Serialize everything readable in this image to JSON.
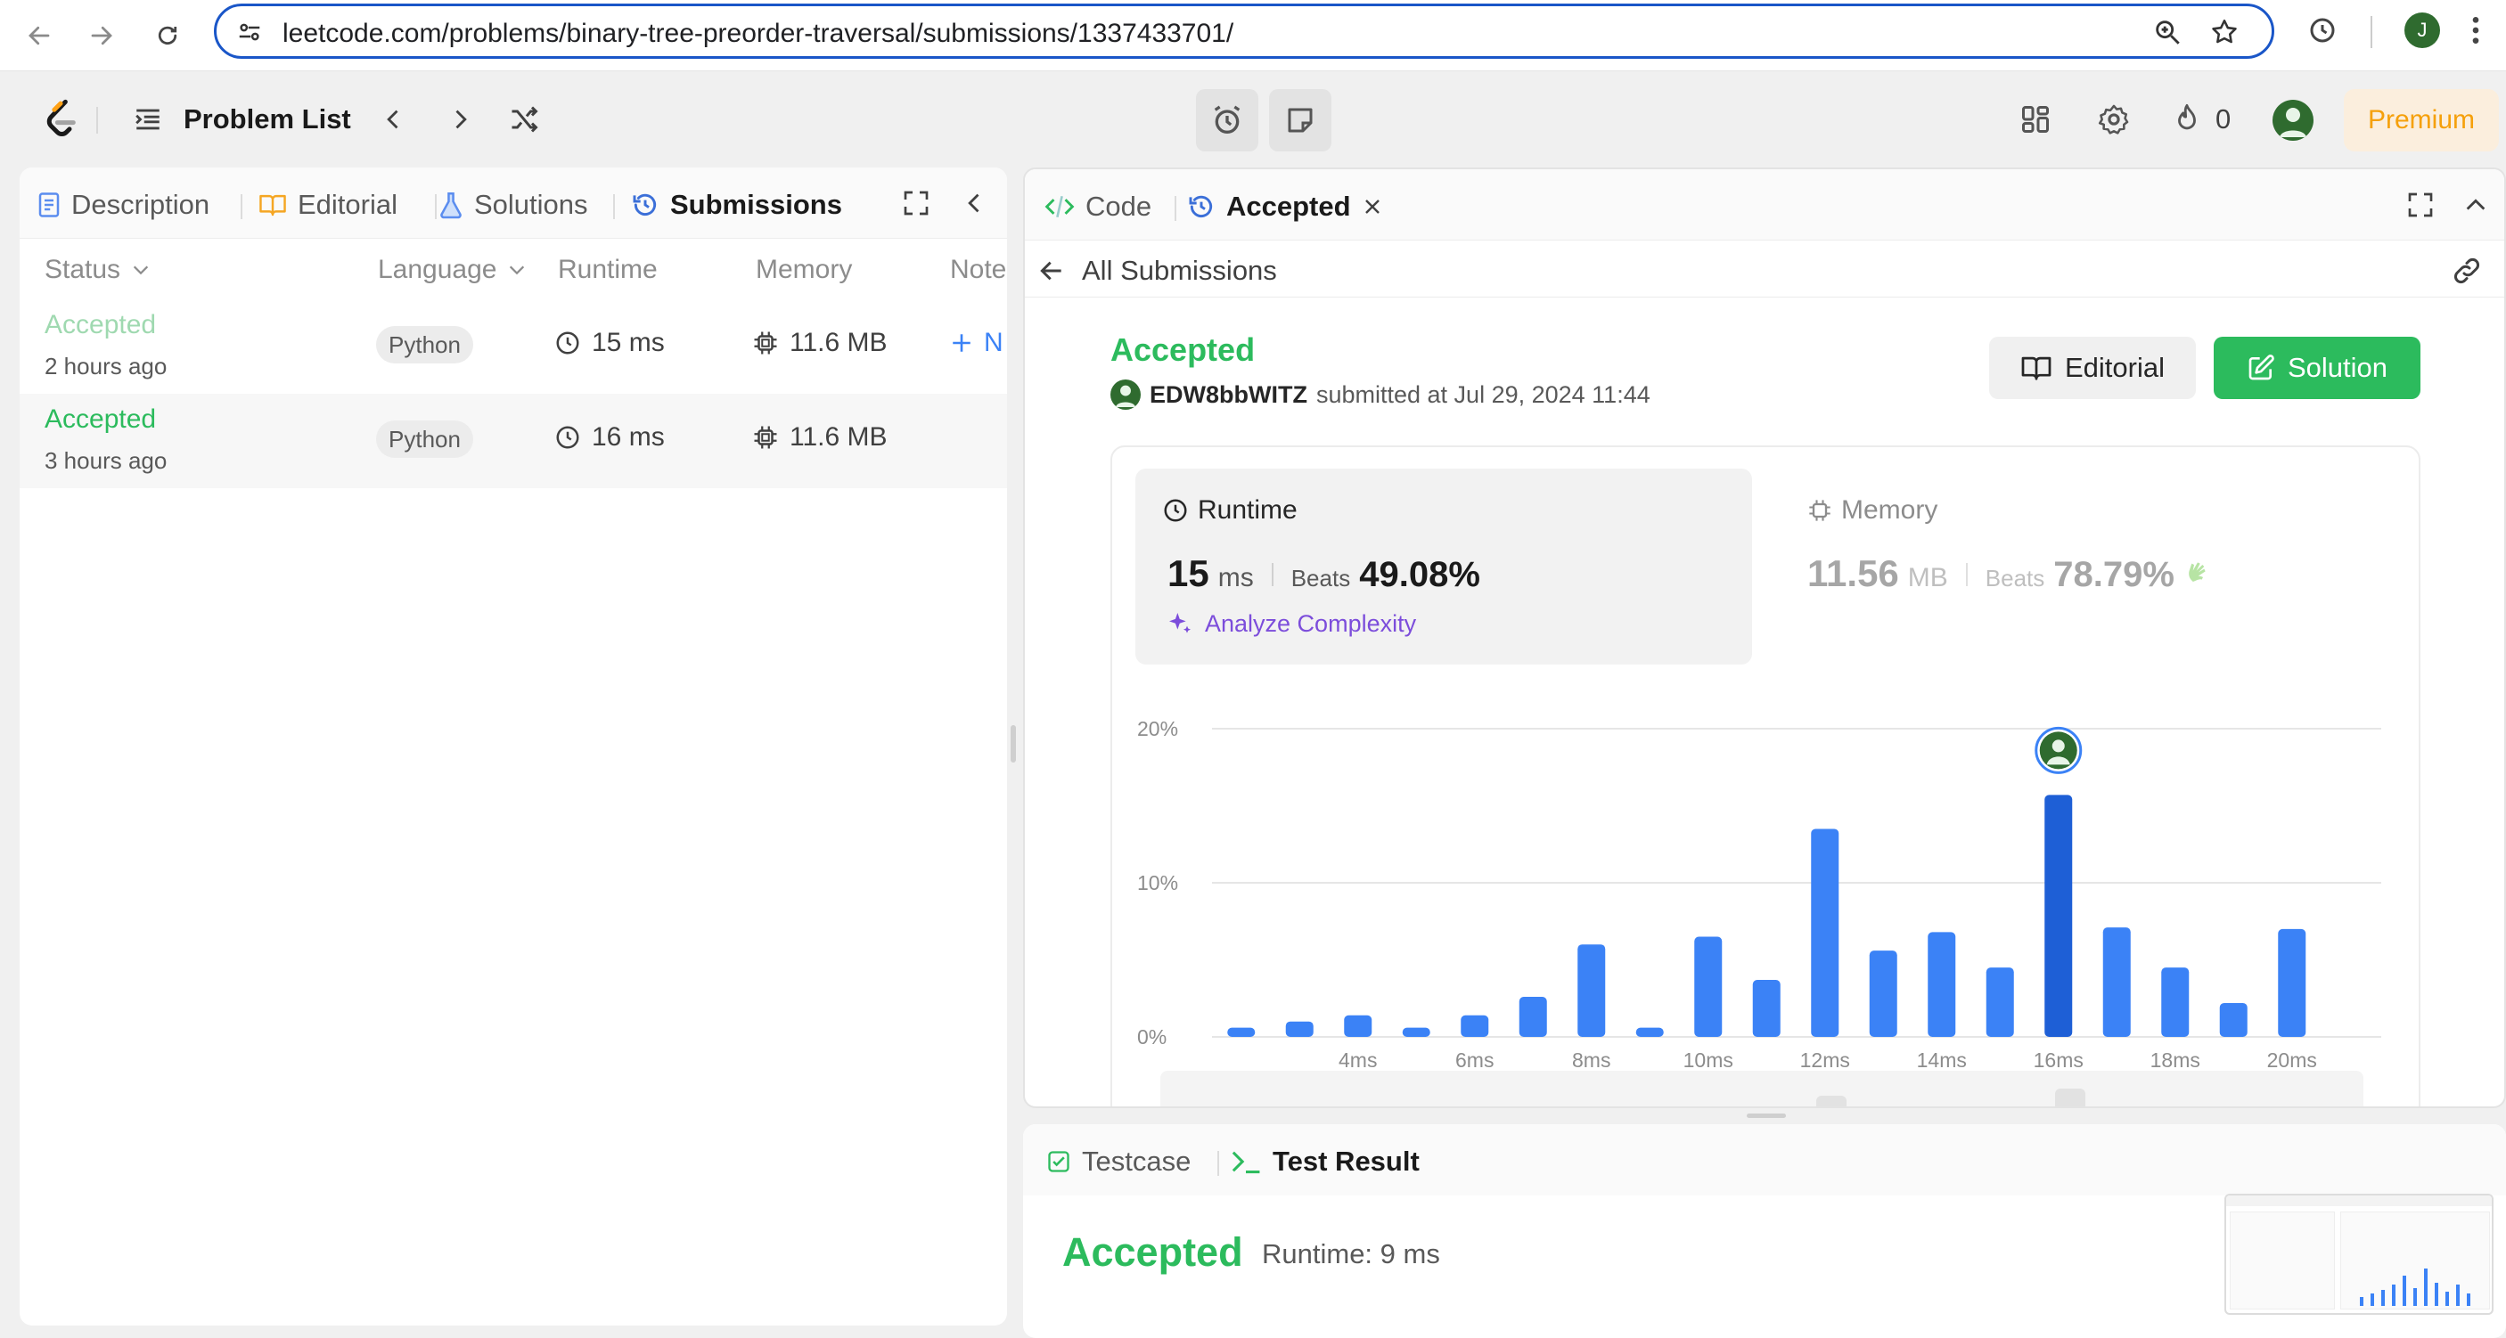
{
  "browser": {
    "url": "leetcode.com/problems/binary-tree-preorder-traversal/submissions/1337433701/",
    "profile_initial": "J"
  },
  "header": {
    "problem_list_label": "Problem List",
    "streak_count": "0",
    "premium_label": "Premium"
  },
  "left_panel": {
    "tabs": [
      {
        "label": "Description",
        "icon": "description-icon"
      },
      {
        "label": "Editorial",
        "icon": "book-icon"
      },
      {
        "label": "Solutions",
        "icon": "flask-icon"
      },
      {
        "label": "Submissions",
        "icon": "history-icon",
        "active": true
      }
    ],
    "columns": {
      "status": "Status",
      "language": "Language",
      "runtime": "Runtime",
      "memory": "Memory",
      "notes": "Note"
    },
    "rows": [
      {
        "status": "Accepted",
        "time_ago": "2 hours ago",
        "language": "Python",
        "runtime": "15 ms",
        "memory": "11.6 MB",
        "note_add": "N"
      },
      {
        "status": "Accepted",
        "time_ago": "3 hours ago",
        "language": "Python",
        "runtime": "16 ms",
        "memory": "11.6 MB"
      }
    ]
  },
  "right_panel": {
    "tabs": [
      {
        "label": "Code",
        "icon": "code-icon"
      },
      {
        "label": "Accepted",
        "icon": "history-icon",
        "active": true
      }
    ],
    "back_label": "All Submissions",
    "status": "Accepted",
    "submitter": "EDW8bbWITZ",
    "submitted_text": "submitted at Jul 29, 2024 11:44",
    "editorial_button": "Editorial",
    "solution_button": "Solution",
    "runtime": {
      "title": "Runtime",
      "value": "15",
      "unit": "ms",
      "beats_label": "Beats",
      "beats_pct": "49.08%",
      "analyze_label": "Analyze Complexity"
    },
    "memory": {
      "title": "Memory",
      "value": "11.56",
      "unit": "MB",
      "beats_label": "Beats",
      "beats_pct": "78.79%"
    }
  },
  "chart_data": {
    "type": "bar",
    "y_ticks": [
      "20%",
      "10%",
      "0%"
    ],
    "ylim": [
      0,
      20
    ],
    "x_tick_labels": [
      "4ms",
      "6ms",
      "8ms",
      "10ms",
      "12ms",
      "14ms",
      "16ms",
      "18ms",
      "20ms"
    ],
    "x": [
      1,
      2,
      3,
      4,
      5,
      6,
      7,
      8,
      9,
      10,
      11,
      12,
      13,
      14,
      15,
      16,
      17,
      18,
      19,
      20
    ],
    "values": [
      0.6,
      1.0,
      1.4,
      0.6,
      1.4,
      2.6,
      6.0,
      0.6,
      6.5,
      3.7,
      13.5,
      5.6,
      6.8,
      4.5,
      15.7,
      7.1,
      4.5,
      2.2,
      7.0,
      0.0
    ],
    "highlight_x": 15,
    "colors": {
      "bar": "#3b82f6",
      "highlight": "#1e5fd6",
      "grid": "#e6e6e6"
    }
  },
  "bottom_panel": {
    "tabs": [
      {
        "label": "Testcase",
        "icon": "checkbox-icon"
      },
      {
        "label": "Test Result",
        "icon": "terminal-icon",
        "active": true
      }
    ],
    "result": "Accepted",
    "runtime_text": "Runtime: 9 ms"
  }
}
